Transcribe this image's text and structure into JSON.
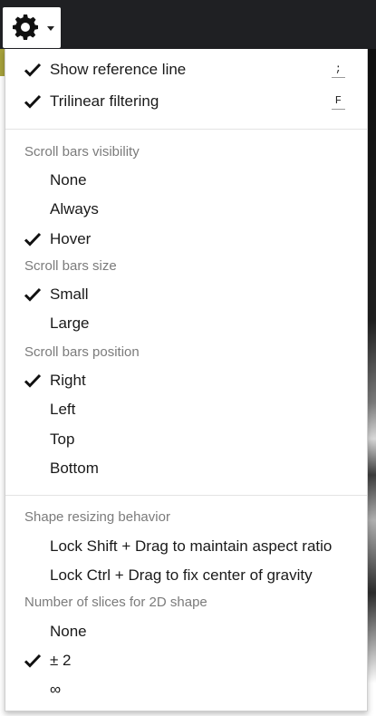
{
  "toolbar": {
    "settings_icon": "gear-icon",
    "dropdown_icon": "caret-down-icon"
  },
  "menu": {
    "top_items": [
      {
        "label": "Show reference line",
        "checked": true,
        "shortcut": ";"
      },
      {
        "label": "Trilinear filtering",
        "checked": true,
        "shortcut": "F"
      }
    ],
    "scroll_visibility": {
      "header": "Scroll bars visibility",
      "options": [
        {
          "label": "None",
          "checked": false
        },
        {
          "label": "Always",
          "checked": false
        },
        {
          "label": "Hover",
          "checked": true
        }
      ]
    },
    "scroll_size": {
      "header": "Scroll bars size",
      "options": [
        {
          "label": "Small",
          "checked": true
        },
        {
          "label": "Large",
          "checked": false
        }
      ]
    },
    "scroll_position": {
      "header": "Scroll bars position",
      "options": [
        {
          "label": "Right",
          "checked": true
        },
        {
          "label": "Left",
          "checked": false
        },
        {
          "label": "Top",
          "checked": false
        },
        {
          "label": "Bottom",
          "checked": false
        }
      ]
    },
    "shape_resizing": {
      "header": "Shape resizing behavior",
      "options": [
        {
          "label": "Lock Shift + Drag to maintain aspect ratio",
          "checked": false
        },
        {
          "label": "Lock Ctrl + Drag to fix center of gravity",
          "checked": false
        }
      ]
    },
    "slices": {
      "header": "Number of slices for 2D shape",
      "options": [
        {
          "label": "None",
          "checked": false
        },
        {
          "label": "± 2",
          "checked": true
        },
        {
          "label": "∞",
          "checked": false
        }
      ]
    }
  },
  "colors": {
    "topbar": "#1f2023",
    "accent_olive": "#a6a13b",
    "header_text": "#7b7b7b",
    "item_text": "#1a1a1a"
  }
}
